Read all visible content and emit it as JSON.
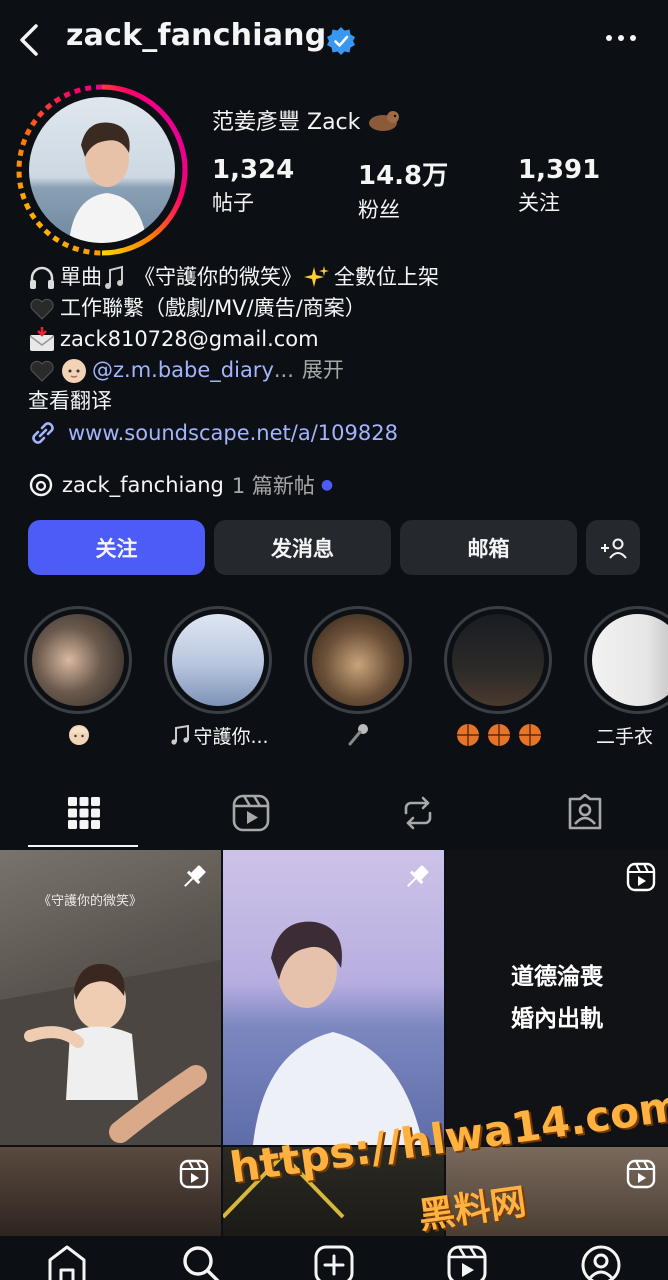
{
  "header": {
    "username": "zack_fanchiang"
  },
  "profile": {
    "display_name": "范姜彥豐 Zack",
    "stats": [
      {
        "value": "1,324",
        "label": "帖子"
      },
      {
        "value": "14.8万",
        "label": "粉丝"
      },
      {
        "value": "1,391",
        "label": "关注"
      }
    ]
  },
  "bio": {
    "line1": "單曲",
    "line1b": "《守護你的微笑》",
    "line1c": "全數位上架",
    "line2": "工作聯繫（戲劇/MV/廣告/商案）",
    "line3": "zack810728@gmail.com",
    "mention": "@z.m.babe_diary",
    "ellipsis": "...",
    "expand": "展开",
    "translate": "查看翻译",
    "link": "www.soundscape.net/a/109828"
  },
  "threads": {
    "handle": "zack_fanchiang",
    "new_posts": "1 篇新帖"
  },
  "buttons": {
    "follow": "关注",
    "message": "发消息",
    "email": "邮箱"
  },
  "highlights": [
    {
      "caption": ""
    },
    {
      "caption": "守護你..."
    },
    {
      "caption": ""
    },
    {
      "caption": ""
    },
    {
      "caption": "二手衣"
    }
  ],
  "grid": {
    "cell1_caption": "《守護你的微笑》",
    "cell3_line1": "道德淪喪",
    "cell3_line2": "婚內出軌"
  },
  "watermark": {
    "url": "https://hlwa14.com",
    "name": "黑料网"
  },
  "colors": {
    "accent": "#4d5cf7",
    "verified": "#3897f0",
    "link": "#a3b4ff",
    "bg": "#0c1014",
    "button": "#25292e"
  }
}
